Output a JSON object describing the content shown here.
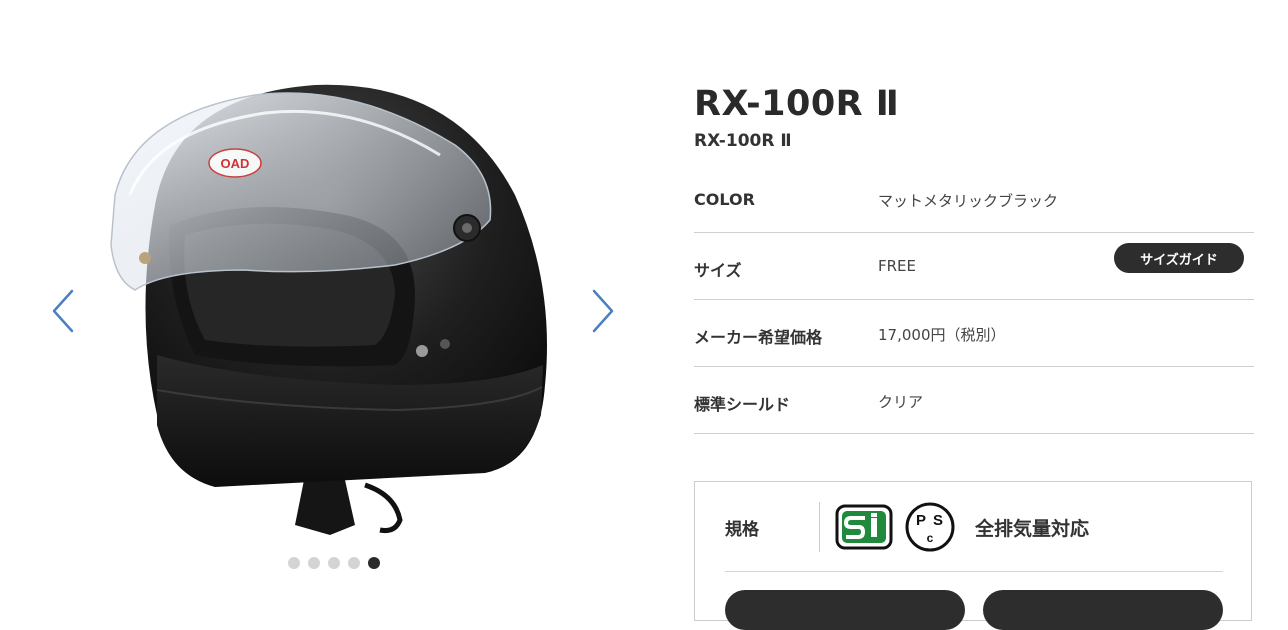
{
  "product": {
    "title": "RX-100R Ⅱ",
    "subtitle": "RX-100R Ⅱ"
  },
  "specs": [
    {
      "label": "COLOR",
      "value": "マットメタリックブラック"
    },
    {
      "label": "サイズ",
      "value": "FREE",
      "button": "サイズガイド"
    },
    {
      "label": "メーカー希望価格",
      "value": "17,000円（税別）"
    },
    {
      "label": "標準シールド",
      "value": "クリア"
    }
  ],
  "standards": {
    "label": "規格",
    "note": "全排気量対応",
    "marks": [
      {
        "name": "SG",
        "icon": "sg-mark-icon"
      },
      {
        "name": "PSC",
        "icon": "psc-mark-icon",
        "letters": [
          "P",
          "S",
          "C"
        ]
      }
    ]
  },
  "gallery": {
    "dot_count": 5,
    "active_index": 4,
    "logo_text": "OAD",
    "prev_icon": "chevron-left-icon",
    "next_icon": "chevron-right-icon"
  },
  "colors": {
    "accent_blue": "#4a7fc0",
    "dark": "#2d2d2d",
    "sg_green": "#1f8a3c"
  }
}
